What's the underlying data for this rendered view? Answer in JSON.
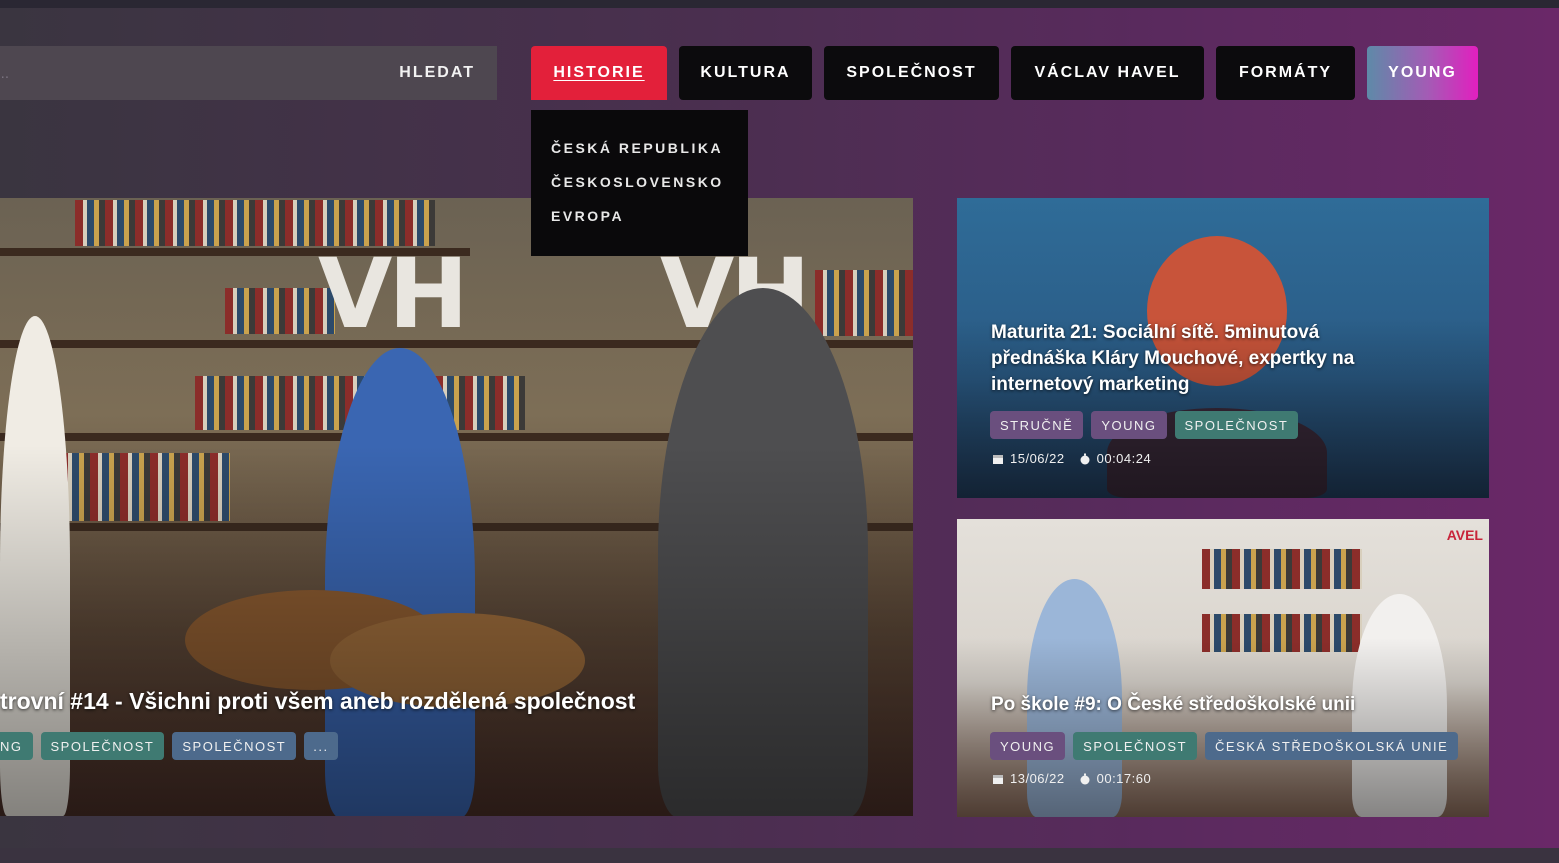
{
  "search": {
    "placeholder": "to...",
    "button_label": "HLEDAT"
  },
  "nav": {
    "items": [
      {
        "label": "HISTORIE"
      },
      {
        "label": "KULTURA"
      },
      {
        "label": "SPOLEČNOST"
      },
      {
        "label": "VÁCLAV HAVEL"
      },
      {
        "label": "FORMÁTY"
      },
      {
        "label": "YOUNG"
      }
    ],
    "dropdown": [
      {
        "label": "ČESKÁ REPUBLIKA"
      },
      {
        "label": "ČESKOSLOVENSKO"
      },
      {
        "label": "EVROPA"
      }
    ]
  },
  "colors": {
    "active": "#e3203a",
    "young_gradient_end": "#e21fbf"
  },
  "featured": {
    "title": "trovní #14 - Všichni proti všem aneb rozdělená společnost",
    "tags": [
      "NG",
      "SPOLEČNOST",
      "SPOLEČNOST",
      "..."
    ],
    "image_letters": "VH"
  },
  "side": [
    {
      "title_line1": "Maturita 21: Sociální sítě. 5minutová",
      "title_line2": "přednáška Kláry Mouchové, expertky na",
      "title_line3": "internetový marketing",
      "tags": [
        "STRUČNĚ",
        "YOUNG",
        "SPOLEČNOST"
      ],
      "date": "15/06/22",
      "duration": "00:04:24"
    },
    {
      "title": "Po škole #9: O České středoškolské unii",
      "tags": [
        "YOUNG",
        "SPOLEČNOST",
        "ČESKÁ STŘEDOŠKOLSKÁ UNIE"
      ],
      "date": "13/06/22",
      "duration": "00:17:60",
      "logo": "AVEL"
    }
  ]
}
